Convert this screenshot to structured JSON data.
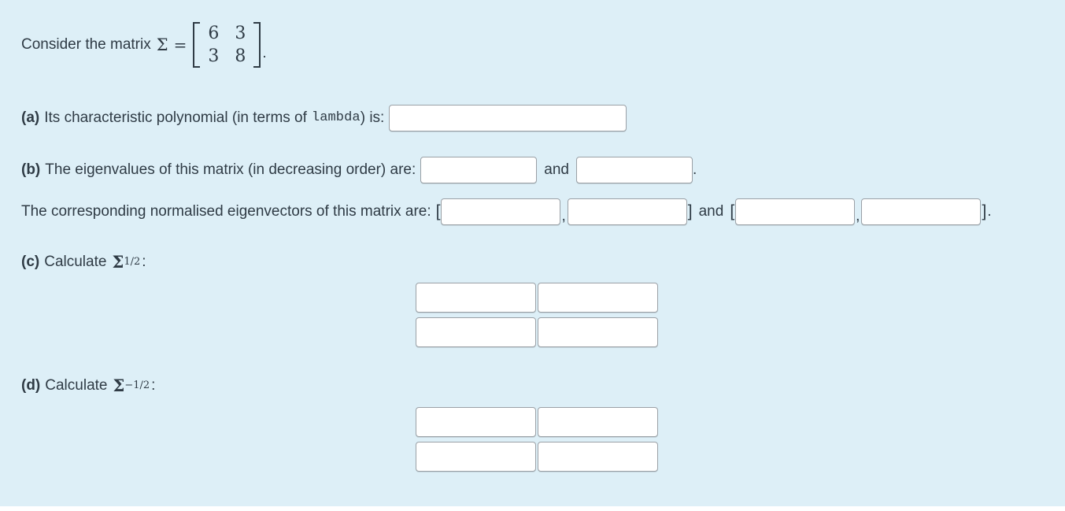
{
  "question": {
    "intro": {
      "lead_text": "Consider the matrix",
      "sigma_symbol": "Σ",
      "equals": "=",
      "matrix": [
        [
          "6",
          "3"
        ],
        [
          "3",
          "8"
        ]
      ],
      "trailing_punctuation": "."
    },
    "parts": [
      {
        "label": "(a)",
        "text_before_mono": "Its characteristic polynomial (in terms of",
        "mono_term": "lambda",
        "text_after_mono": ") is:",
        "input_value": "",
        "input_placeholder": ""
      },
      {
        "label": "(b)",
        "text": "The eigenvalues of this matrix (in decreasing order) are:",
        "conjunction": "and",
        "trailing_punctuation": ".",
        "input_1_value": "",
        "input_2_value": "",
        "input_placeholder": ""
      }
    ],
    "eigenvectors": {
      "text": "The corresponding normalised eigenvectors of this matrix are:",
      "open_bracket": "[",
      "close_bracket": "]",
      "comma": ",",
      "conjunction": "and",
      "trailing_punctuation": ".",
      "input_1_value": "",
      "input_2_value": "",
      "input_3_value": "",
      "input_4_value": "",
      "input_placeholder": ""
    },
    "part_c": {
      "label": "(c)",
      "text": "Calculate",
      "sigma_symbol": "Σ",
      "exponent": "1/2",
      "colon": ":",
      "matrix_inputs": [
        [
          "",
          ""
        ],
        [
          "",
          ""
        ]
      ],
      "input_placeholder": ""
    },
    "part_d": {
      "label": "(d)",
      "text": "Calculate",
      "sigma_symbol": "Σ",
      "exponent": "−1/2",
      "colon": ":",
      "matrix_inputs": [
        [
          "",
          ""
        ],
        [
          "",
          ""
        ]
      ],
      "input_placeholder": ""
    }
  },
  "colors": {
    "panel_background": "#ddeff7",
    "page_background": "#ffffff",
    "text": "#2f3b45",
    "input_border": "#9aa0a6",
    "input_background": "#ffffff"
  }
}
